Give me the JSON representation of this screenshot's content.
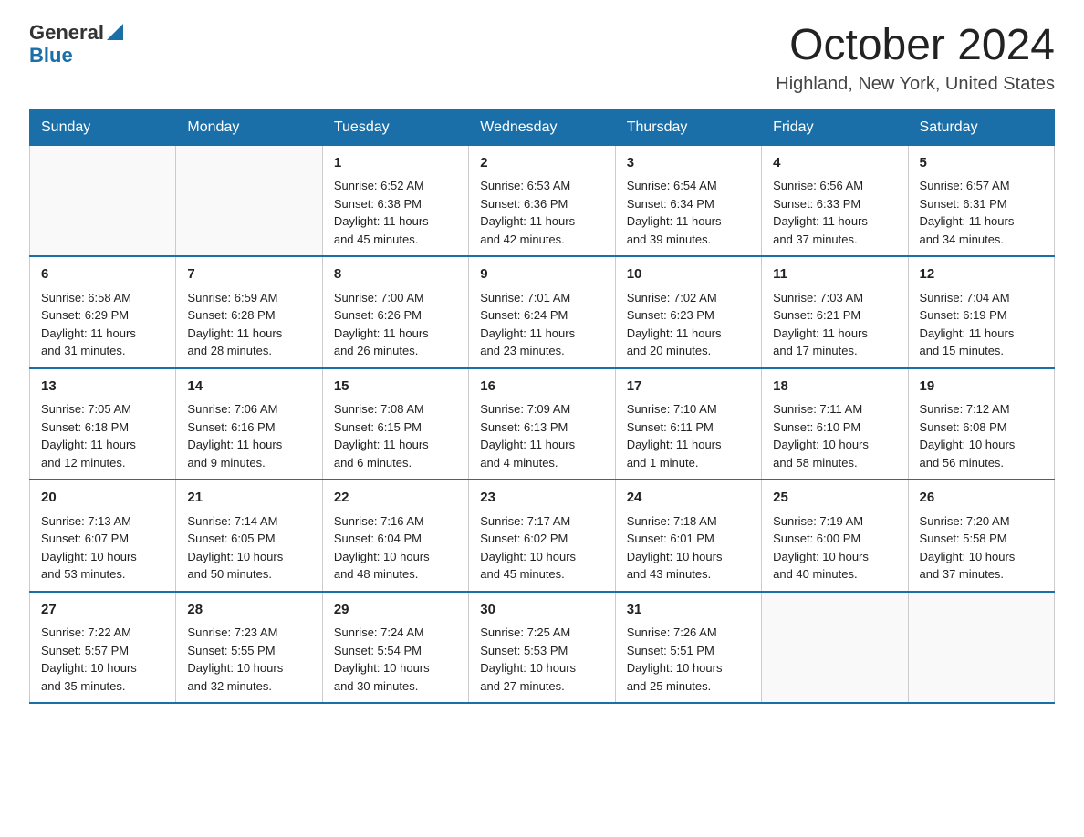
{
  "logo": {
    "general": "General",
    "blue": "Blue"
  },
  "title": "October 2024",
  "location": "Highland, New York, United States",
  "weekdays": [
    "Sunday",
    "Monday",
    "Tuesday",
    "Wednesday",
    "Thursday",
    "Friday",
    "Saturday"
  ],
  "weeks": [
    [
      {
        "day": "",
        "info": ""
      },
      {
        "day": "",
        "info": ""
      },
      {
        "day": "1",
        "info": "Sunrise: 6:52 AM\nSunset: 6:38 PM\nDaylight: 11 hours\nand 45 minutes."
      },
      {
        "day": "2",
        "info": "Sunrise: 6:53 AM\nSunset: 6:36 PM\nDaylight: 11 hours\nand 42 minutes."
      },
      {
        "day": "3",
        "info": "Sunrise: 6:54 AM\nSunset: 6:34 PM\nDaylight: 11 hours\nand 39 minutes."
      },
      {
        "day": "4",
        "info": "Sunrise: 6:56 AM\nSunset: 6:33 PM\nDaylight: 11 hours\nand 37 minutes."
      },
      {
        "day": "5",
        "info": "Sunrise: 6:57 AM\nSunset: 6:31 PM\nDaylight: 11 hours\nand 34 minutes."
      }
    ],
    [
      {
        "day": "6",
        "info": "Sunrise: 6:58 AM\nSunset: 6:29 PM\nDaylight: 11 hours\nand 31 minutes."
      },
      {
        "day": "7",
        "info": "Sunrise: 6:59 AM\nSunset: 6:28 PM\nDaylight: 11 hours\nand 28 minutes."
      },
      {
        "day": "8",
        "info": "Sunrise: 7:00 AM\nSunset: 6:26 PM\nDaylight: 11 hours\nand 26 minutes."
      },
      {
        "day": "9",
        "info": "Sunrise: 7:01 AM\nSunset: 6:24 PM\nDaylight: 11 hours\nand 23 minutes."
      },
      {
        "day": "10",
        "info": "Sunrise: 7:02 AM\nSunset: 6:23 PM\nDaylight: 11 hours\nand 20 minutes."
      },
      {
        "day": "11",
        "info": "Sunrise: 7:03 AM\nSunset: 6:21 PM\nDaylight: 11 hours\nand 17 minutes."
      },
      {
        "day": "12",
        "info": "Sunrise: 7:04 AM\nSunset: 6:19 PM\nDaylight: 11 hours\nand 15 minutes."
      }
    ],
    [
      {
        "day": "13",
        "info": "Sunrise: 7:05 AM\nSunset: 6:18 PM\nDaylight: 11 hours\nand 12 minutes."
      },
      {
        "day": "14",
        "info": "Sunrise: 7:06 AM\nSunset: 6:16 PM\nDaylight: 11 hours\nand 9 minutes."
      },
      {
        "day": "15",
        "info": "Sunrise: 7:08 AM\nSunset: 6:15 PM\nDaylight: 11 hours\nand 6 minutes."
      },
      {
        "day": "16",
        "info": "Sunrise: 7:09 AM\nSunset: 6:13 PM\nDaylight: 11 hours\nand 4 minutes."
      },
      {
        "day": "17",
        "info": "Sunrise: 7:10 AM\nSunset: 6:11 PM\nDaylight: 11 hours\nand 1 minute."
      },
      {
        "day": "18",
        "info": "Sunrise: 7:11 AM\nSunset: 6:10 PM\nDaylight: 10 hours\nand 58 minutes."
      },
      {
        "day": "19",
        "info": "Sunrise: 7:12 AM\nSunset: 6:08 PM\nDaylight: 10 hours\nand 56 minutes."
      }
    ],
    [
      {
        "day": "20",
        "info": "Sunrise: 7:13 AM\nSunset: 6:07 PM\nDaylight: 10 hours\nand 53 minutes."
      },
      {
        "day": "21",
        "info": "Sunrise: 7:14 AM\nSunset: 6:05 PM\nDaylight: 10 hours\nand 50 minutes."
      },
      {
        "day": "22",
        "info": "Sunrise: 7:16 AM\nSunset: 6:04 PM\nDaylight: 10 hours\nand 48 minutes."
      },
      {
        "day": "23",
        "info": "Sunrise: 7:17 AM\nSunset: 6:02 PM\nDaylight: 10 hours\nand 45 minutes."
      },
      {
        "day": "24",
        "info": "Sunrise: 7:18 AM\nSunset: 6:01 PM\nDaylight: 10 hours\nand 43 minutes."
      },
      {
        "day": "25",
        "info": "Sunrise: 7:19 AM\nSunset: 6:00 PM\nDaylight: 10 hours\nand 40 minutes."
      },
      {
        "day": "26",
        "info": "Sunrise: 7:20 AM\nSunset: 5:58 PM\nDaylight: 10 hours\nand 37 minutes."
      }
    ],
    [
      {
        "day": "27",
        "info": "Sunrise: 7:22 AM\nSunset: 5:57 PM\nDaylight: 10 hours\nand 35 minutes."
      },
      {
        "day": "28",
        "info": "Sunrise: 7:23 AM\nSunset: 5:55 PM\nDaylight: 10 hours\nand 32 minutes."
      },
      {
        "day": "29",
        "info": "Sunrise: 7:24 AM\nSunset: 5:54 PM\nDaylight: 10 hours\nand 30 minutes."
      },
      {
        "day": "30",
        "info": "Sunrise: 7:25 AM\nSunset: 5:53 PM\nDaylight: 10 hours\nand 27 minutes."
      },
      {
        "day": "31",
        "info": "Sunrise: 7:26 AM\nSunset: 5:51 PM\nDaylight: 10 hours\nand 25 minutes."
      },
      {
        "day": "",
        "info": ""
      },
      {
        "day": "",
        "info": ""
      }
    ]
  ]
}
